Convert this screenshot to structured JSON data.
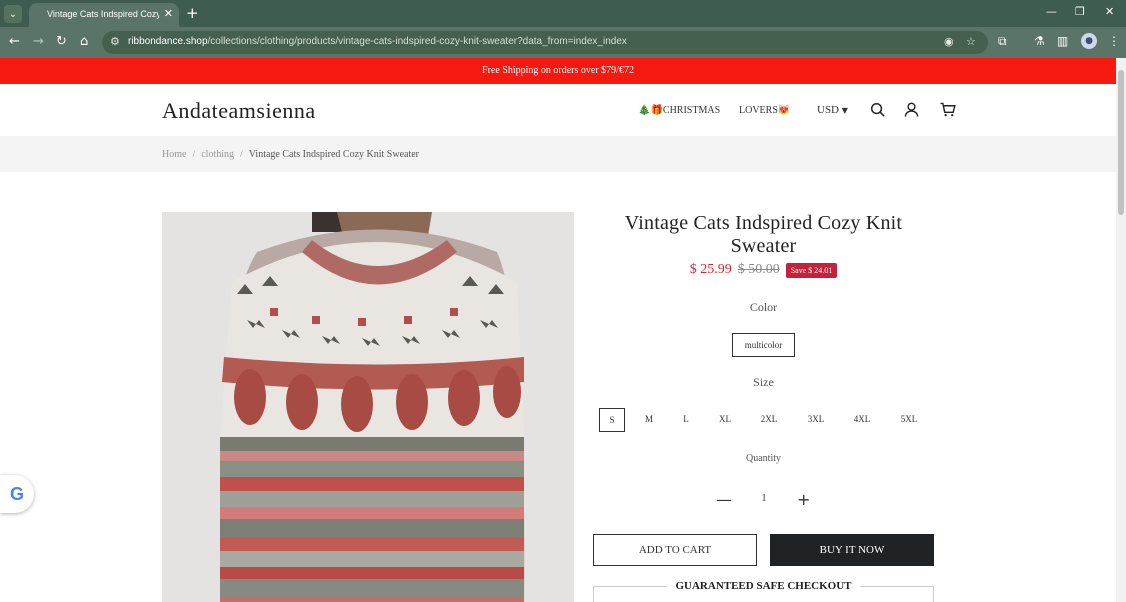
{
  "browser": {
    "tab_title": "Vintage Cats Indspired Cozy Kn",
    "url_host": "ribbondance.shop",
    "url_path": "/collections/clothing/products/vintage-cats-indspired-cozy-knit-sweater?data_from=index_index",
    "icons": [
      "tab-list-icon",
      "close-icon",
      "new-tab-icon",
      "minimize-icon",
      "restore-icon",
      "window-close-icon",
      "back-icon",
      "forward-icon",
      "reload-icon",
      "home-icon",
      "site-info-icon",
      "eye-off-icon",
      "star-icon",
      "extensions-icon",
      "labs-icon",
      "sidebar-icon",
      "profile-icon",
      "menu-icon"
    ]
  },
  "announcement": "Free Shipping on orders over $79/€72",
  "header": {
    "logo": "Andateamsienna",
    "nav": [
      "🎄🎁CHRISTMAS",
      "LOVERS😻"
    ],
    "currency": "USD",
    "icons": [
      "search-icon",
      "account-icon",
      "cart-icon"
    ]
  },
  "breadcrumb": {
    "items": [
      "Home",
      "clothing",
      "Vintage Cats Indspired Cozy Knit Sweater"
    ],
    "separator": "/"
  },
  "product": {
    "title": "Vintage Cats Indspired Cozy Knit Sweater",
    "price": "$ 25.99",
    "compare_price": "$ 50.00",
    "save": "Save $ 24.01",
    "color_label": "Color",
    "color_option": "multicolor",
    "size_label": "Size",
    "sizes": [
      "S",
      "M",
      "L",
      "XL",
      "2XL",
      "3XL",
      "4XL",
      "5XL"
    ],
    "selected_size": "S",
    "quantity_label": "Quantity",
    "quantity": "1",
    "add_to_cart": "ADD TO CART",
    "buy_now": "BUY IT NOW",
    "safe_checkout": "GUARANTEED SAFE CHECKOUT"
  },
  "colors": {
    "chrome": "#3e5c4f",
    "announcement_bg": "#f5190f",
    "price": "#e0222d",
    "save_badge": "#c6213a",
    "buy_button": "#1f2325"
  }
}
